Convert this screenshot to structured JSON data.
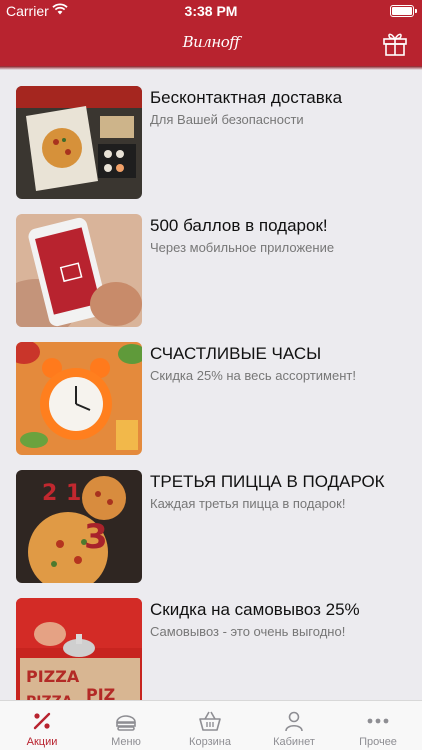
{
  "status_bar": {
    "carrier": "Carrier",
    "time": "3:38 PM"
  },
  "header": {
    "logo_text": "Вилнoff",
    "gift_icon": "gift-icon",
    "brand_color": "#b8232f"
  },
  "promos": [
    {
      "title": "Бесконтактная доставка",
      "subtitle": "Для Вашей безопасности",
      "image": "pizza-box-delivery"
    },
    {
      "title": "500 баллов в подарок!",
      "subtitle": "Через мобильное приложение",
      "image": "phone-app-gift"
    },
    {
      "title": "СЧАСТЛИВЫЕ ЧАСЫ",
      "subtitle": "Скидка 25% на весь ассортимент!",
      "image": "orange-alarm-clock"
    },
    {
      "title": "ТРЕТЬЯ ПИЦЦА В ПОДАРОК",
      "subtitle": "Каждая третья пицца в подарок!",
      "image": "three-pizzas"
    },
    {
      "title": "Скидка на самовывоз 25%",
      "subtitle": "Самовывоз - это очень выгодно!",
      "image": "pickup-counter-bell"
    }
  ],
  "tabs": [
    {
      "label": "Акции",
      "icon": "percent-icon",
      "active": true
    },
    {
      "label": "Меню",
      "icon": "food-menu-icon",
      "active": false
    },
    {
      "label": "Корзина",
      "icon": "basket-icon",
      "active": false
    },
    {
      "label": "Кабинет",
      "icon": "person-icon",
      "active": false
    },
    {
      "label": "Прочее",
      "icon": "more-icon",
      "active": false
    }
  ]
}
